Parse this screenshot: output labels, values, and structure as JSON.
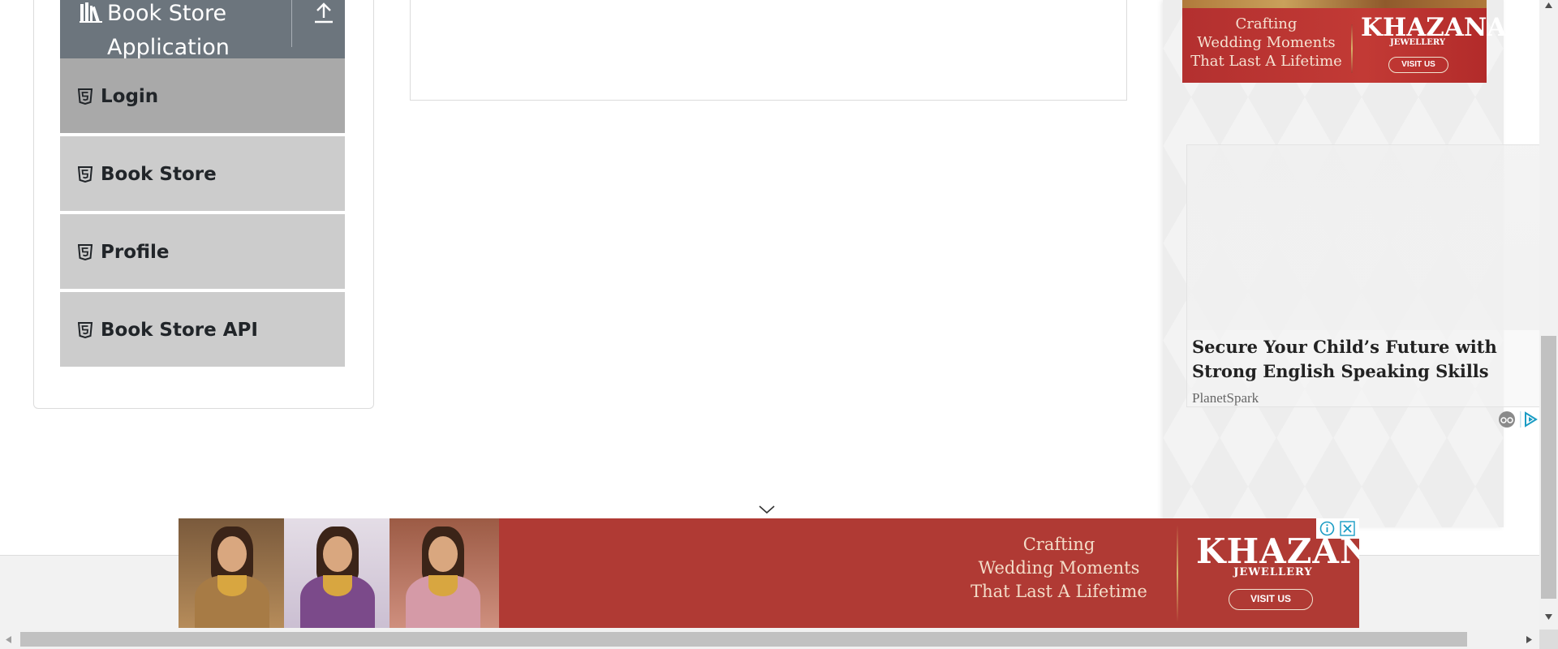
{
  "sidebar": {
    "group_title": "Book Store Application",
    "items": [
      {
        "label": "Login",
        "active": true
      },
      {
        "label": "Book Store",
        "active": false
      },
      {
        "label": "Profile",
        "active": false
      },
      {
        "label": "Book Store API",
        "active": false
      }
    ]
  },
  "side_ads": {
    "banner": {
      "tagline_1": "Crafting",
      "tagline_2": "Wedding Moments",
      "tagline_3": "That Last A Lifetime",
      "brand": "KHAZANA",
      "brand_sub": "JEWELLERY",
      "cta": "VISIT US"
    },
    "native": {
      "headline": "Secure Your Child’s Future with Strong English Speaking Skills",
      "advertiser": "PlanetSpark"
    }
  },
  "anchor_ad": {
    "tagline_1": "Crafting",
    "tagline_2": "Wedding Moments",
    "tagline_3": "That Last A Lifetime",
    "brand": "KHAZANA",
    "brand_sub": "JEWELLERY",
    "cta": "VISIT US"
  },
  "colors": {
    "header_gray": "#6c757d",
    "menu_item": "#cccccc",
    "menu_item_active": "#a9a9a9",
    "ad_red": "#b03a34"
  },
  "icons": {
    "group": "books-icon",
    "collapse": "upload-icon",
    "menu_item": "html5-icon",
    "ad_info": "info-icon",
    "ad_close": "close-icon",
    "scroll_hint": "chevron-down-icon"
  }
}
